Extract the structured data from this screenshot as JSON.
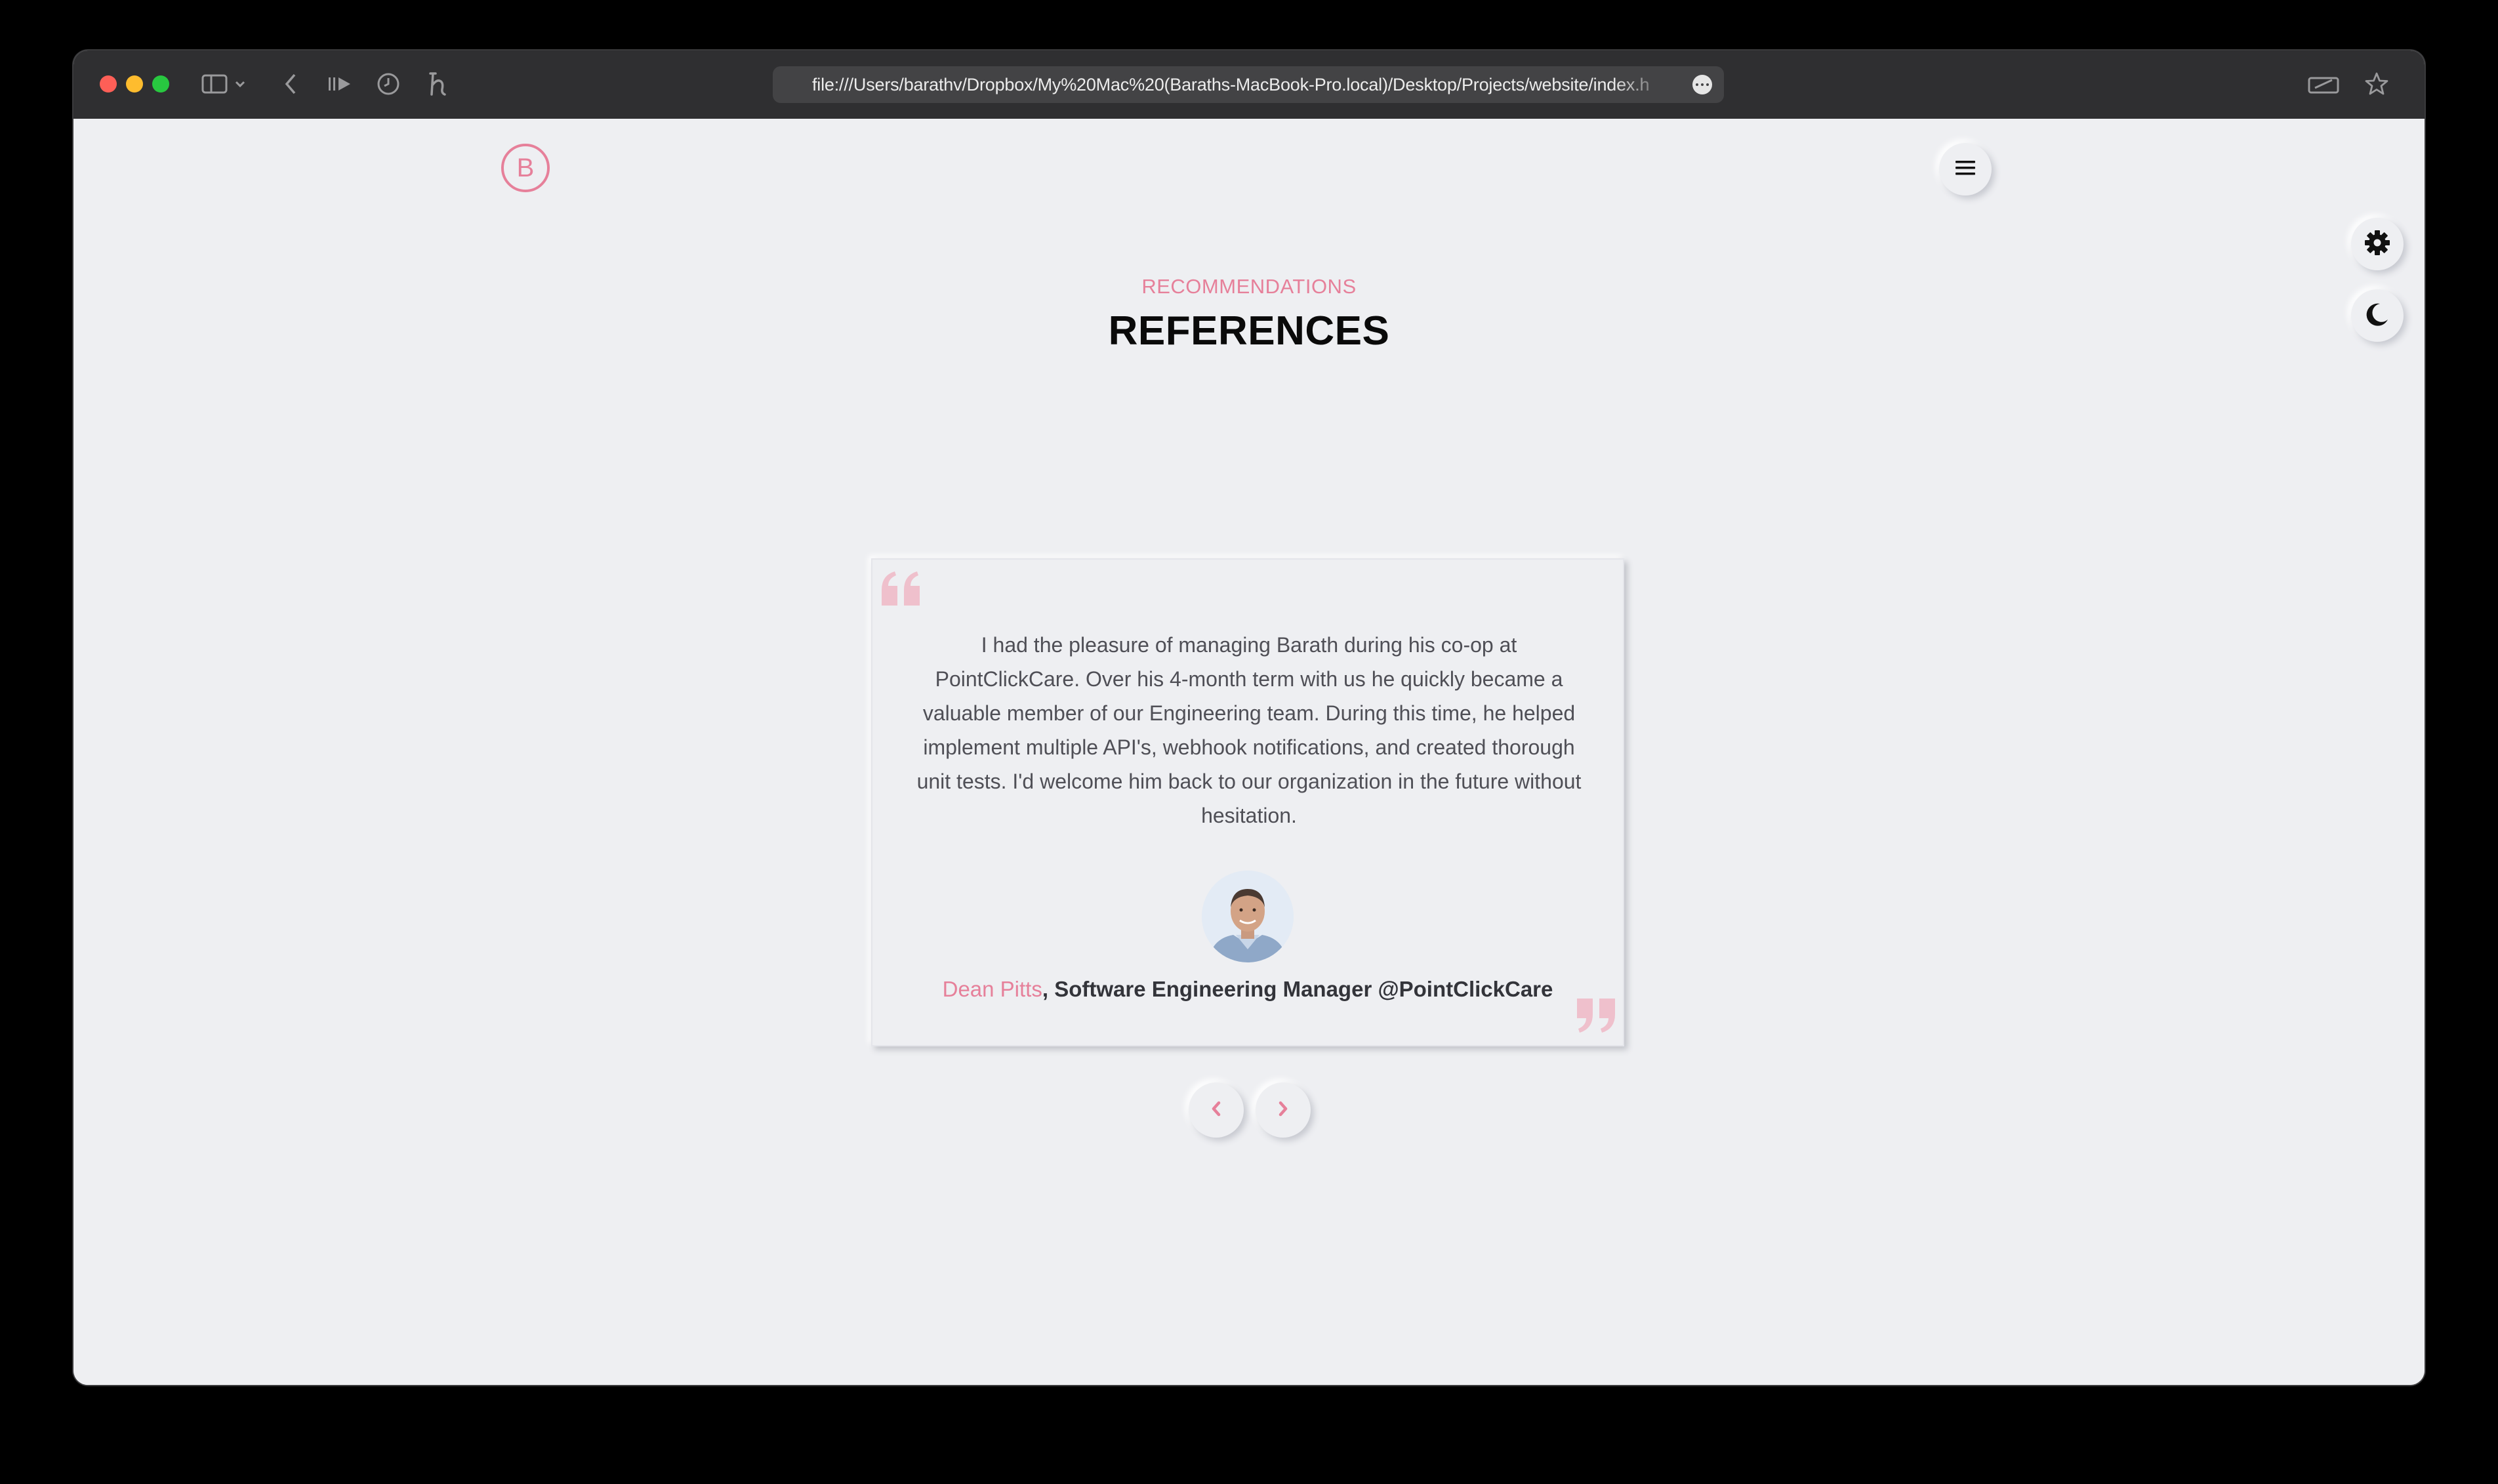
{
  "browser": {
    "url": "file:///Users/barathv/Dropbox/My%20Mac%20(Baraths-MacBook-Pro.local)/Desktop/Projects/website/index.h"
  },
  "site": {
    "logo_letter": "B"
  },
  "section": {
    "subtitle": "RECOMMENDATIONS",
    "title": "REFERENCES"
  },
  "testimonial": {
    "text": "I had the pleasure of managing Barath during his co-op at PointClickCare. Over his 4-month term with us he quickly became a valuable member of our Engineering team. During this time, he helped implement multiple API's, webhook notifications, and created thorough unit tests. I'd welcome him back to our organization in the future without hesitation.",
    "author_name": "Dean Pitts",
    "author_role": ", Software Engineering Manager @PointClickCare"
  },
  "colors": {
    "accent": "#e6809a",
    "background": "#eeeff2",
    "titlebar": "#2f2f31"
  },
  "icons": {
    "menu": "hamburger-icon",
    "settings": "gear-icon",
    "theme": "moon-icon",
    "prev": "chevron-left-icon",
    "next": "chevron-right-icon"
  }
}
